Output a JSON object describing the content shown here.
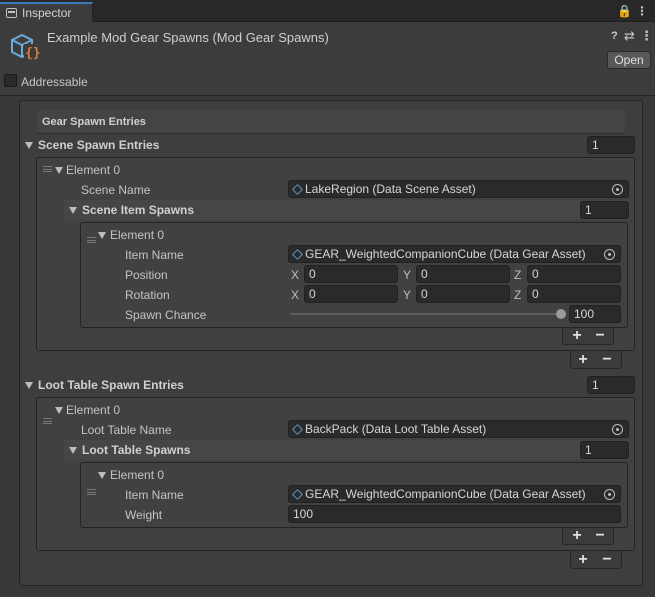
{
  "tab": {
    "label": "Inspector"
  },
  "header": {
    "title": "Example Mod Gear Spawns (Mod Gear Spawns)",
    "open_label": "Open",
    "addressable_label": "Addressable"
  },
  "section_title": "Gear Spawn Entries",
  "scene_spawn": {
    "label": "Scene Spawn Entries",
    "count": "1",
    "element_label": "Element 0",
    "scene_name_label": "Scene Name",
    "scene_name_value": "LakeRegion (Data Scene Asset)",
    "item_spawns_label": "Scene Item Spawns",
    "item_spawns_count": "1",
    "item": {
      "element_label": "Element 0",
      "item_name_label": "Item Name",
      "item_name_value": "GEAR_WeightedCompanionCube (Data Gear Asset)",
      "position_label": "Position",
      "rotation_label": "Rotation",
      "x_label": "X",
      "y_label": "Y",
      "z_label": "Z",
      "pos_x": "0",
      "pos_y": "0",
      "pos_z": "0",
      "rot_x": "0",
      "rot_y": "0",
      "rot_z": "0",
      "spawn_chance_label": "Spawn Chance",
      "spawn_chance_value": "100",
      "spawn_chance_fraction": 1.0
    }
  },
  "loot_spawn": {
    "label": "Loot Table Spawn Entries",
    "count": "1",
    "element_label": "Element 0",
    "loot_name_label": "Loot Table Name",
    "loot_name_value": "BackPack (Data Loot Table Asset)",
    "table_spawns_label": "Loot Table Spawns",
    "table_spawns_count": "1",
    "item": {
      "element_label": "Element 0",
      "item_name_label": "Item Name",
      "item_name_value": "GEAR_WeightedCompanionCube (Data Gear Asset)",
      "weight_label": "Weight",
      "weight_value": "100"
    }
  },
  "buttons": {
    "plus": "+",
    "minus": "−"
  },
  "colors": {
    "accent": "#3a79bb",
    "asset_icon": "#6aaadc",
    "script_icon_brace": "#e07a3a"
  }
}
